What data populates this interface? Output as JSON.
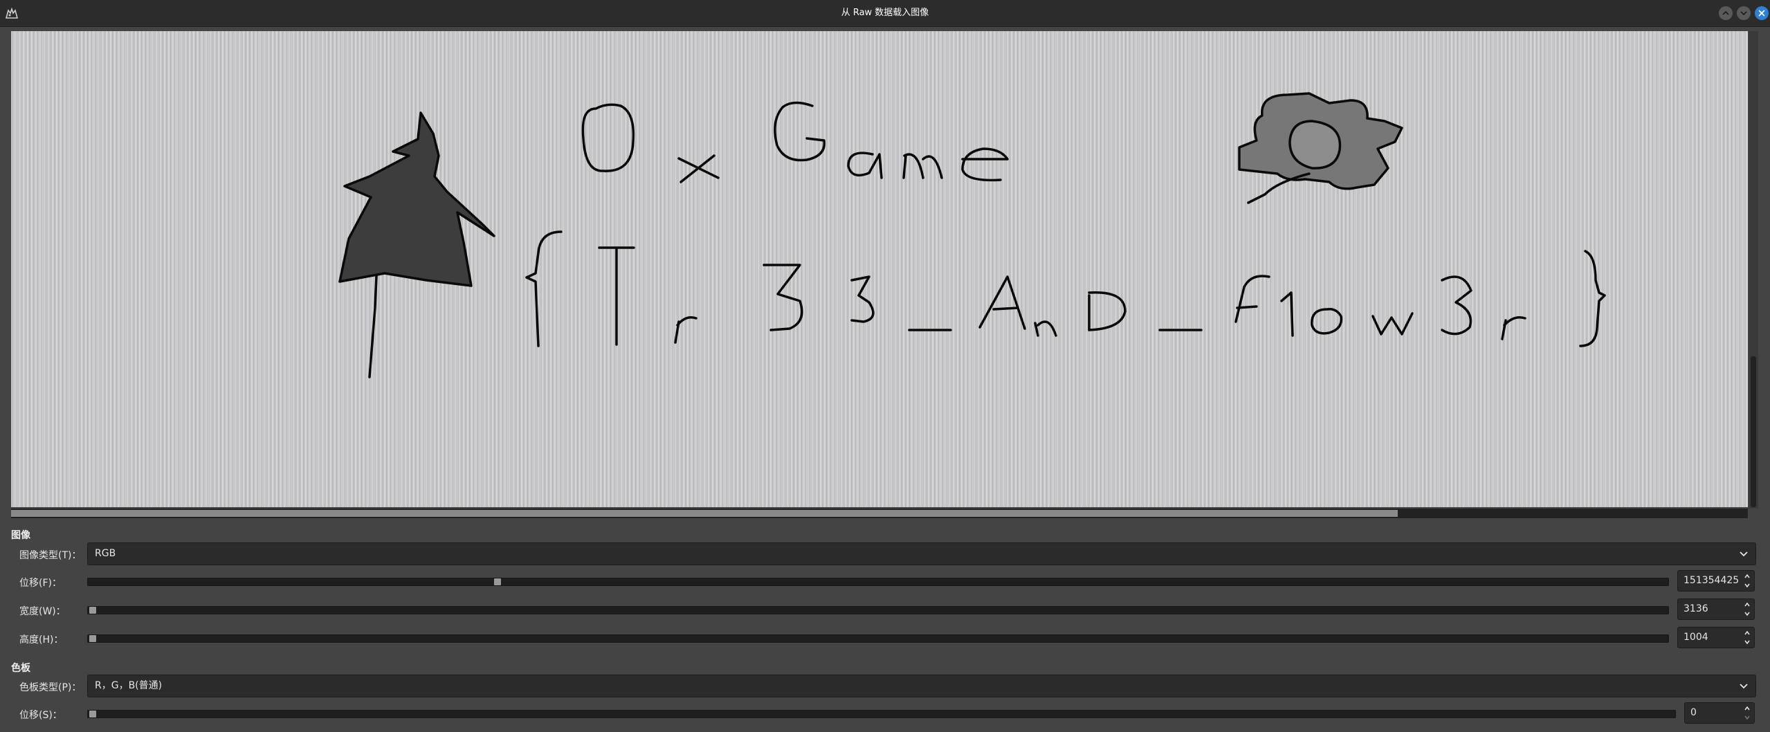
{
  "window": {
    "title": "从 Raw 数据载入图像",
    "icon": "gimp-wilber-icon",
    "buttons": [
      "minimize",
      "maximize",
      "close"
    ]
  },
  "preview": {
    "drawing_text_line1": "0xGame",
    "drawing_text_line2": "{Tr33_AnD_F1ow3r}"
  },
  "image_section": {
    "heading": "图像",
    "image_type_label": "图像类型(T)：",
    "image_type_value": "RGB",
    "offset_label": "位移(F)：",
    "offset_value": "151354425",
    "offset_slider_fraction": 0.259,
    "width_label": "宽度(W)：",
    "width_value": "3136",
    "width_slider_fraction": 0.0,
    "height_label": "高度(H)：",
    "height_value": "1004",
    "height_slider_fraction": 0.0
  },
  "palette_section": {
    "heading": "色板",
    "palette_type_label": "色板类型(P)：",
    "palette_type_value": "R，G，B(普通)",
    "offset_label": "位移(S)：",
    "offset_value": "0",
    "offset_slider_fraction": 0.0
  },
  "colors": {
    "background": "#444444",
    "titlebar": "#2c2c2c",
    "close_button": "#2f7fd4",
    "field": "#2b2b2b"
  }
}
